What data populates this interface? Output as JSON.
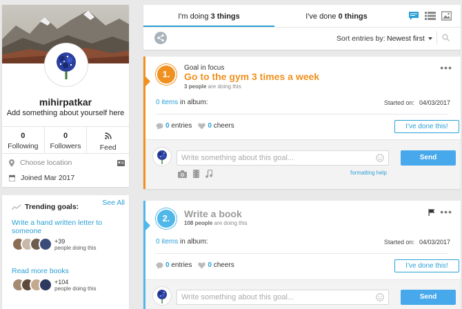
{
  "profile": {
    "username": "mihirpatkar",
    "bio": "Add something about yourself here",
    "stats": [
      {
        "value": "0",
        "label": "Following"
      },
      {
        "value": "0",
        "label": "Followers"
      },
      {
        "value": "",
        "label": "Feed"
      }
    ],
    "location_placeholder": "Choose location",
    "joined": "Joined Mar 2017"
  },
  "trending": {
    "heading": "Trending goals:",
    "see_all": "See All",
    "goals": [
      {
        "title": "Write a hand written letter to someone",
        "count": "+39",
        "count_label": "people doing this"
      },
      {
        "title": "Read more books",
        "count": "+104",
        "count_label": "people doing this"
      }
    ]
  },
  "tabs": {
    "doing_prefix": "I'm doing ",
    "doing_count": "3 things",
    "done_prefix": "I've done ",
    "done_count": "0 things"
  },
  "sort": {
    "label": "Sort entries by:",
    "value": "Newest first"
  },
  "goals": [
    {
      "number": "1.",
      "kicker": "Goal in focus",
      "title": "Go to the gym 3 times a week",
      "people_count": "3 people",
      "people_suffix": " are doing this",
      "items_count": "0 items",
      "items_suffix": " in album:",
      "started_label": "Started on:",
      "started_date": "04/03/2017",
      "entries_count": "0",
      "entries_label": " entries",
      "cheers_count": "0",
      "cheers_label": " cheers",
      "done_label": "I've done this!",
      "compose_placeholder": "Write something about this goal...",
      "send_label": "Send",
      "formatting_help": "formatting help",
      "accent": "#f0901e"
    },
    {
      "number": "2.",
      "kicker": "",
      "title": "Write a book",
      "people_count": "108 people",
      "people_suffix": " are doing this",
      "items_count": "0 items",
      "items_suffix": " in album:",
      "started_label": "Started on:",
      "started_date": "04/03/2017",
      "entries_count": "0",
      "entries_label": " entries",
      "cheers_count": "0",
      "cheers_label": " cheers",
      "done_label": "I've done this!",
      "compose_placeholder": "Write something about this goal...",
      "send_label": "Send",
      "accent": "#4fb8e8"
    }
  ]
}
